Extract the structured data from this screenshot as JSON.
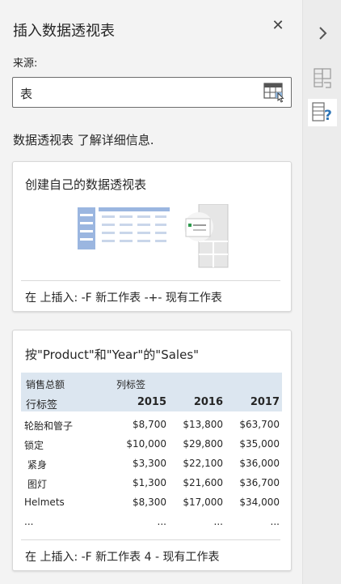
{
  "panel": {
    "title": "插入数据透视表",
    "close_icon": "close-icon"
  },
  "source": {
    "label": "来源:",
    "value": "表"
  },
  "learn_more": "数据透视表 了解详细信息.",
  "card_create": {
    "title": "创建自己的数据透视表",
    "insert_text": "在 上插入:  -F 新工作表 -+- 现有工作表"
  },
  "card_recommended": {
    "title": "按\"Product\"和\"Year\"的\"Sales\"",
    "header_value_label": "销售总额",
    "header_col_label": "列标签",
    "header_row_label": "行标签",
    "years": [
      "2015",
      "2016",
      "2017"
    ],
    "rows": [
      {
        "label": "轮胎和管子",
        "v2015": "$8,700",
        "v2016": "$13,800",
        "v2017": "$63,700"
      },
      {
        "label": "锁定",
        "v2015": "$10,000",
        "v2016": "$29,800",
        "v2017": "$35,000"
      },
      {
        "label": "紧身",
        "v2015": "$3,300",
        "v2016": "$22,100",
        "v2017": "$36,000"
      },
      {
        "label": "图灯",
        "v2015": "$1,300",
        "v2016": "$21,600",
        "v2017": "$36,700"
      },
      {
        "label": "Helmets",
        "v2015": "$8,300",
        "v2016": "$17,000",
        "v2017": "$34,000"
      }
    ],
    "ellipsis": "...",
    "insert_text": "在 上插入:  -F 新工作表 4 - 现有工作表"
  },
  "rail": {
    "collapse_icon": "chevron-right-icon",
    "buttons": [
      "pivot-fields-icon",
      "recommended-pivot-icon"
    ]
  },
  "colors": {
    "header_fill": "#dce6f0",
    "accent_blue": "#2e75b6"
  }
}
